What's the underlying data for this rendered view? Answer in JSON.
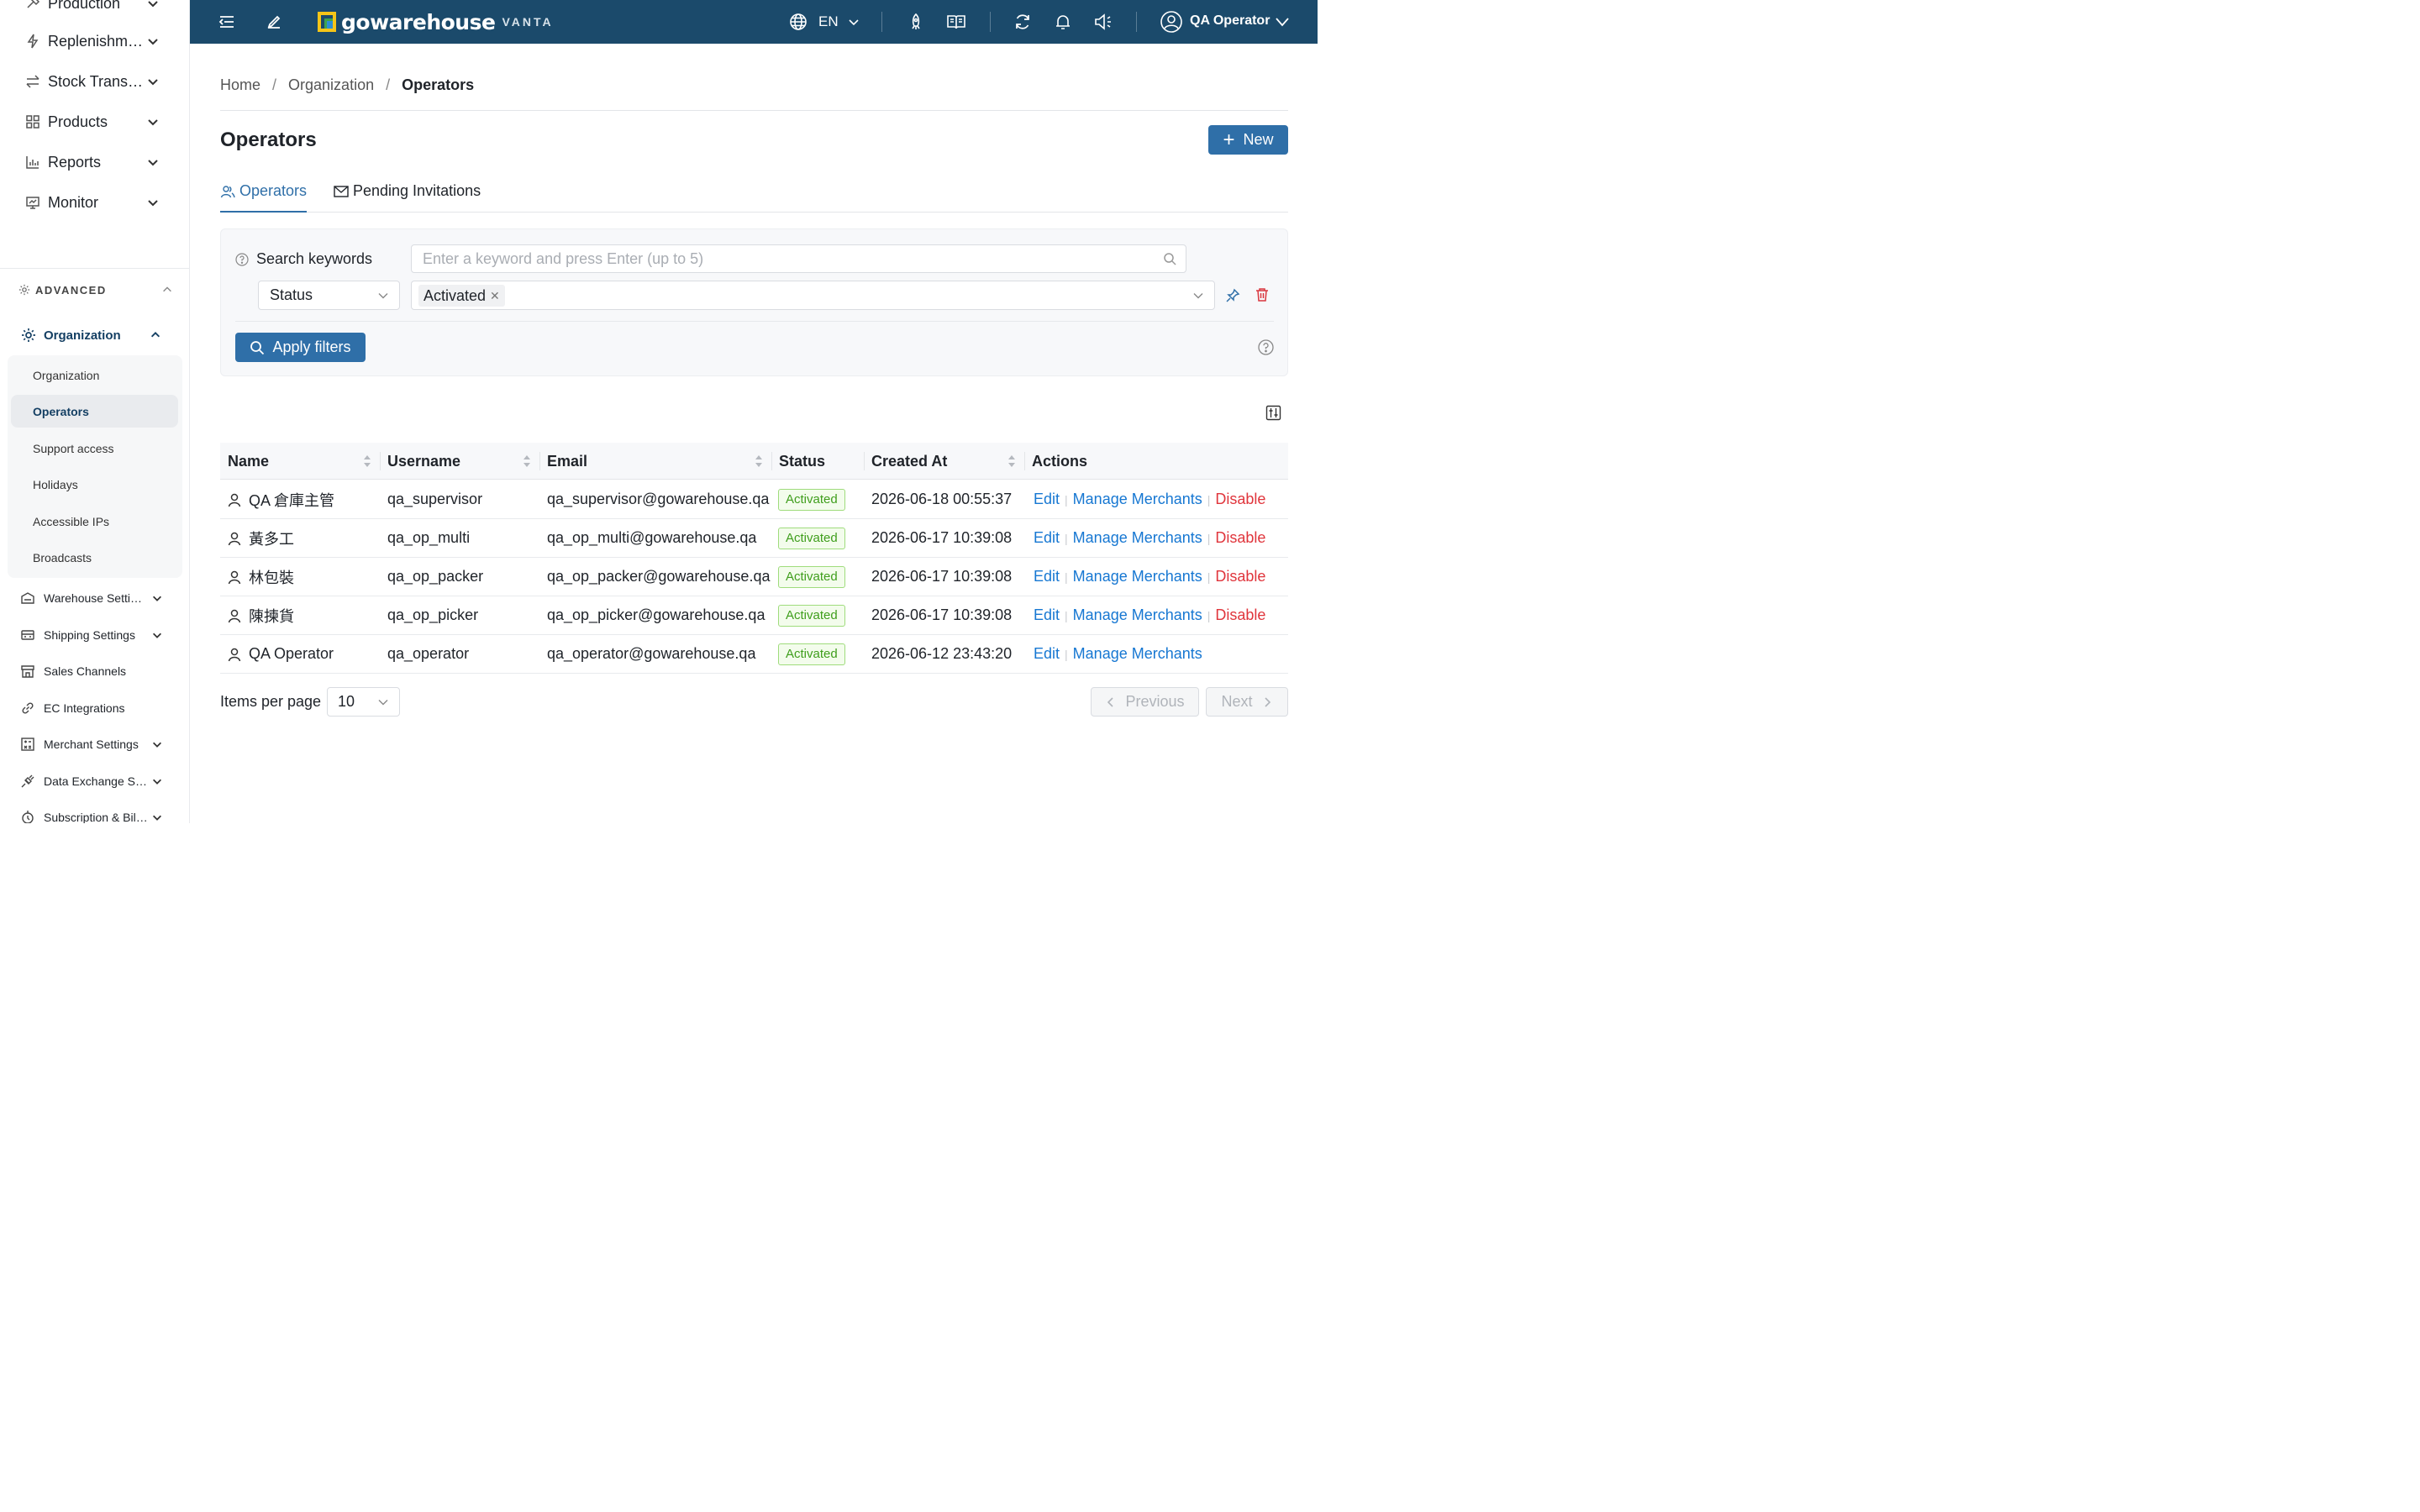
{
  "sidebar": {
    "top_items": [
      {
        "label": "Production",
        "icon": "production-icon"
      },
      {
        "label": "Replenishment",
        "icon": "bolt-icon"
      },
      {
        "label": "Stock Transfers",
        "icon": "transfer-icon"
      },
      {
        "label": "Products",
        "icon": "grid-icon"
      },
      {
        "label": "Reports",
        "icon": "bar-chart-icon"
      },
      {
        "label": "Monitor",
        "icon": "monitor-icon"
      }
    ],
    "advanced_label": "ADVANCED",
    "organization_label": "Organization",
    "sub_items": [
      {
        "label": "Organization",
        "active": false
      },
      {
        "label": "Operators",
        "active": true
      },
      {
        "label": "Support access",
        "active": false
      },
      {
        "label": "Holidays",
        "active": false
      },
      {
        "label": "Accessible IPs",
        "active": false
      },
      {
        "label": "Broadcasts",
        "active": false
      }
    ],
    "lower_items": [
      {
        "label": "Warehouse Settings",
        "icon": "warehouse-icon",
        "has_children": true
      },
      {
        "label": "Shipping Settings",
        "icon": "truck-icon",
        "has_children": true
      },
      {
        "label": "Sales Channels",
        "icon": "store-icon",
        "has_children": false
      },
      {
        "label": "EC Integrations",
        "icon": "link-icon",
        "has_children": false
      },
      {
        "label": "Merchant Settings",
        "icon": "calculator-icon",
        "has_children": true
      },
      {
        "label": "Data Exchange Settings",
        "icon": "plug-icon",
        "has_children": true
      },
      {
        "label": "Subscription & Billing",
        "icon": "subscription-icon",
        "has_children": true
      }
    ]
  },
  "header": {
    "brand_name": "gowarehouse",
    "brand_sub": "VANTA",
    "language": "EN",
    "user_name": "QA Operator",
    "bg_color": "#1b4a6b"
  },
  "breadcrumb": {
    "home": "Home",
    "organization": "Organization",
    "current": "Operators"
  },
  "page": {
    "title": "Operators",
    "new_button": "New",
    "tabs": {
      "operators": "Operators",
      "pending": "Pending Invitations"
    }
  },
  "filters": {
    "search_label": "Search keywords",
    "search_placeholder": "Enter a keyword and press Enter (up to 5)",
    "status_field": "Status",
    "status_tag": "Activated",
    "apply_label": "Apply filters"
  },
  "table": {
    "columns": {
      "name": "Name",
      "username": "Username",
      "email": "Email",
      "status": "Status",
      "created_at": "Created At",
      "actions": "Actions"
    },
    "action_labels": {
      "edit": "Edit",
      "manage": "Manage Merchants",
      "disable": "Disable"
    },
    "rows": [
      {
        "name": "QA 倉庫主管",
        "username": "qa_supervisor",
        "email": "qa_supervisor@gowarehouse.qa",
        "status": "Activated",
        "created_at": "2026-06-18 00:55:37",
        "can_disable": true
      },
      {
        "name": "黃多工",
        "username": "qa_op_multi",
        "email": "qa_op_multi@gowarehouse.qa",
        "status": "Activated",
        "created_at": "2026-06-17 10:39:08",
        "can_disable": true
      },
      {
        "name": "林包裝",
        "username": "qa_op_packer",
        "email": "qa_op_packer@gowarehouse.qa",
        "status": "Activated",
        "created_at": "2026-06-17 10:39:08",
        "can_disable": true
      },
      {
        "name": "陳揀貨",
        "username": "qa_op_picker",
        "email": "qa_op_picker@gowarehouse.qa",
        "status": "Activated",
        "created_at": "2026-06-17 10:39:08",
        "can_disable": true
      },
      {
        "name": "QA Operator",
        "username": "qa_operator",
        "email": "qa_operator@gowarehouse.qa",
        "status": "Activated",
        "created_at": "2026-06-12 23:43:20",
        "can_disable": false
      }
    ]
  },
  "pagination": {
    "items_per_page_label": "Items per page",
    "items_per_page": "10",
    "previous": "Previous",
    "next": "Next"
  }
}
